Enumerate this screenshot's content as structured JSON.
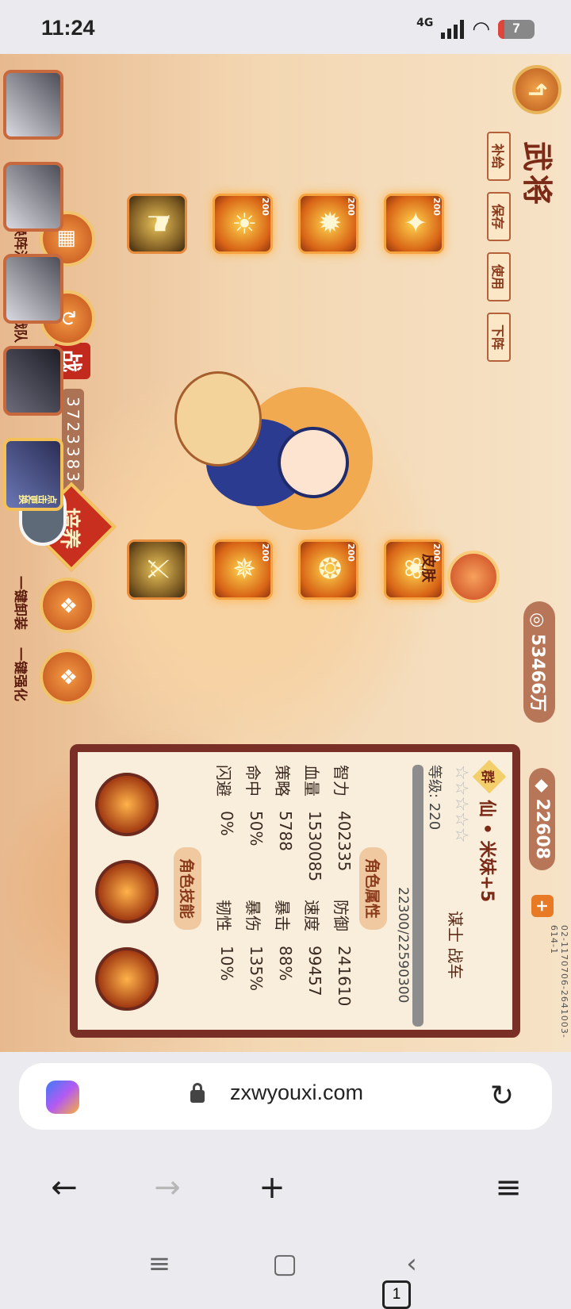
{
  "status_bar": {
    "time": "11:24",
    "network": "4G",
    "battery_level": "7"
  },
  "game": {
    "title": "武将",
    "side_menu": [
      "补给",
      "保存",
      "使用",
      "下阵"
    ],
    "hero_badge": "点击更换",
    "power_label": "战",
    "power_value": "3723383",
    "cultivate_label": "培养",
    "skin_label": "皮肤",
    "buttons": {
      "change_formation": "更换阵法",
      "switch_team": "切换战队",
      "unequip_all": "一键卸装",
      "enhance_all": "一键强化"
    },
    "equip_levels": [
      "200",
      "200",
      "200",
      "200",
      "200",
      "200"
    ],
    "currency": {
      "silver": "53466万",
      "gold": "22608"
    },
    "version": "02-1170706-2641003-614-1",
    "character": {
      "faction": "群",
      "name": "仙 • 米妹+5",
      "stars": 5,
      "level": "等级: 220",
      "exp": "22300/22590300",
      "class_tags": "谋士  战车",
      "section_attr": "角色属性",
      "section_skill": "角色技能",
      "stats": [
        {
          "label": "智力",
          "value": "402335"
        },
        {
          "label": "防御",
          "value": "241610"
        },
        {
          "label": "血量",
          "value": "1530085"
        },
        {
          "label": "速度",
          "value": "99457"
        },
        {
          "label": "策略",
          "value": "5788"
        },
        {
          "label": "暴击",
          "value": "88%"
        },
        {
          "label": "命中",
          "value": "50%"
        },
        {
          "label": "暴伤",
          "value": "135%"
        },
        {
          "label": "闪避",
          "value": "0%"
        },
        {
          "label": "韧性",
          "value": "10%"
        }
      ]
    }
  },
  "browser": {
    "url": "zxwyouxi.com",
    "tabs_count": "1"
  }
}
